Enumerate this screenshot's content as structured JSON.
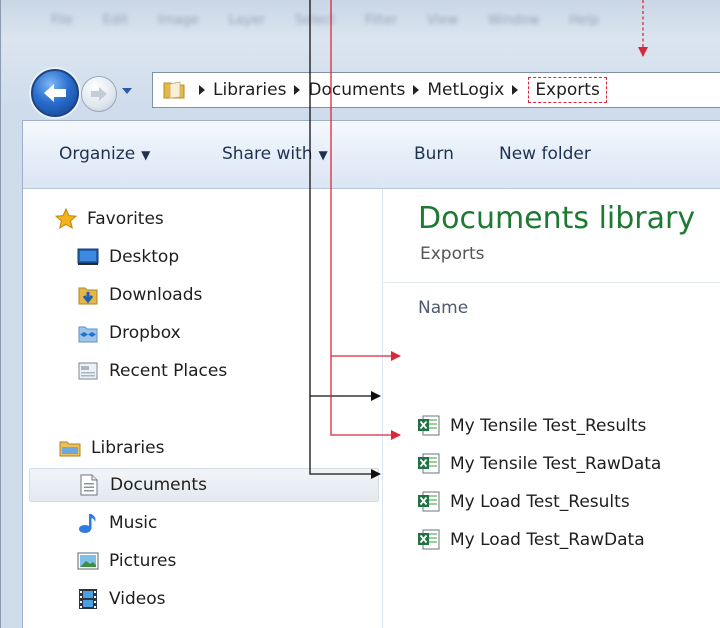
{
  "menu_ghost": [
    "File",
    "Edit",
    "Image",
    "Layer",
    "Select",
    "Filter",
    "View",
    "Window",
    "Help"
  ],
  "address_bar": {
    "crumbs": [
      "Libraries",
      "Documents",
      "MetLogix"
    ],
    "current": "Exports"
  },
  "toolbar": {
    "organize": "Organize",
    "share_with": "Share with",
    "burn": "Burn",
    "new_folder": "New folder"
  },
  "nav_pane": {
    "favorites": {
      "header": "Favorites",
      "items": [
        "Desktop",
        "Downloads",
        "Dropbox",
        "Recent Places"
      ]
    },
    "libraries": {
      "header": "Libraries",
      "items": [
        "Documents",
        "Music",
        "Pictures",
        "Videos"
      ],
      "selected": "Documents"
    }
  },
  "content": {
    "title": "Documents library",
    "subtitle": "Exports",
    "column_header": "Name",
    "files": [
      "My Tensile Test_Results",
      "My Tensile Test_RawData",
      "My Load Test_Results",
      "My Load Test_RawData"
    ]
  },
  "colors": {
    "annotation_red": "#d9283a",
    "annotation_black": "#111111",
    "library_title_green": "#1e7a32"
  }
}
